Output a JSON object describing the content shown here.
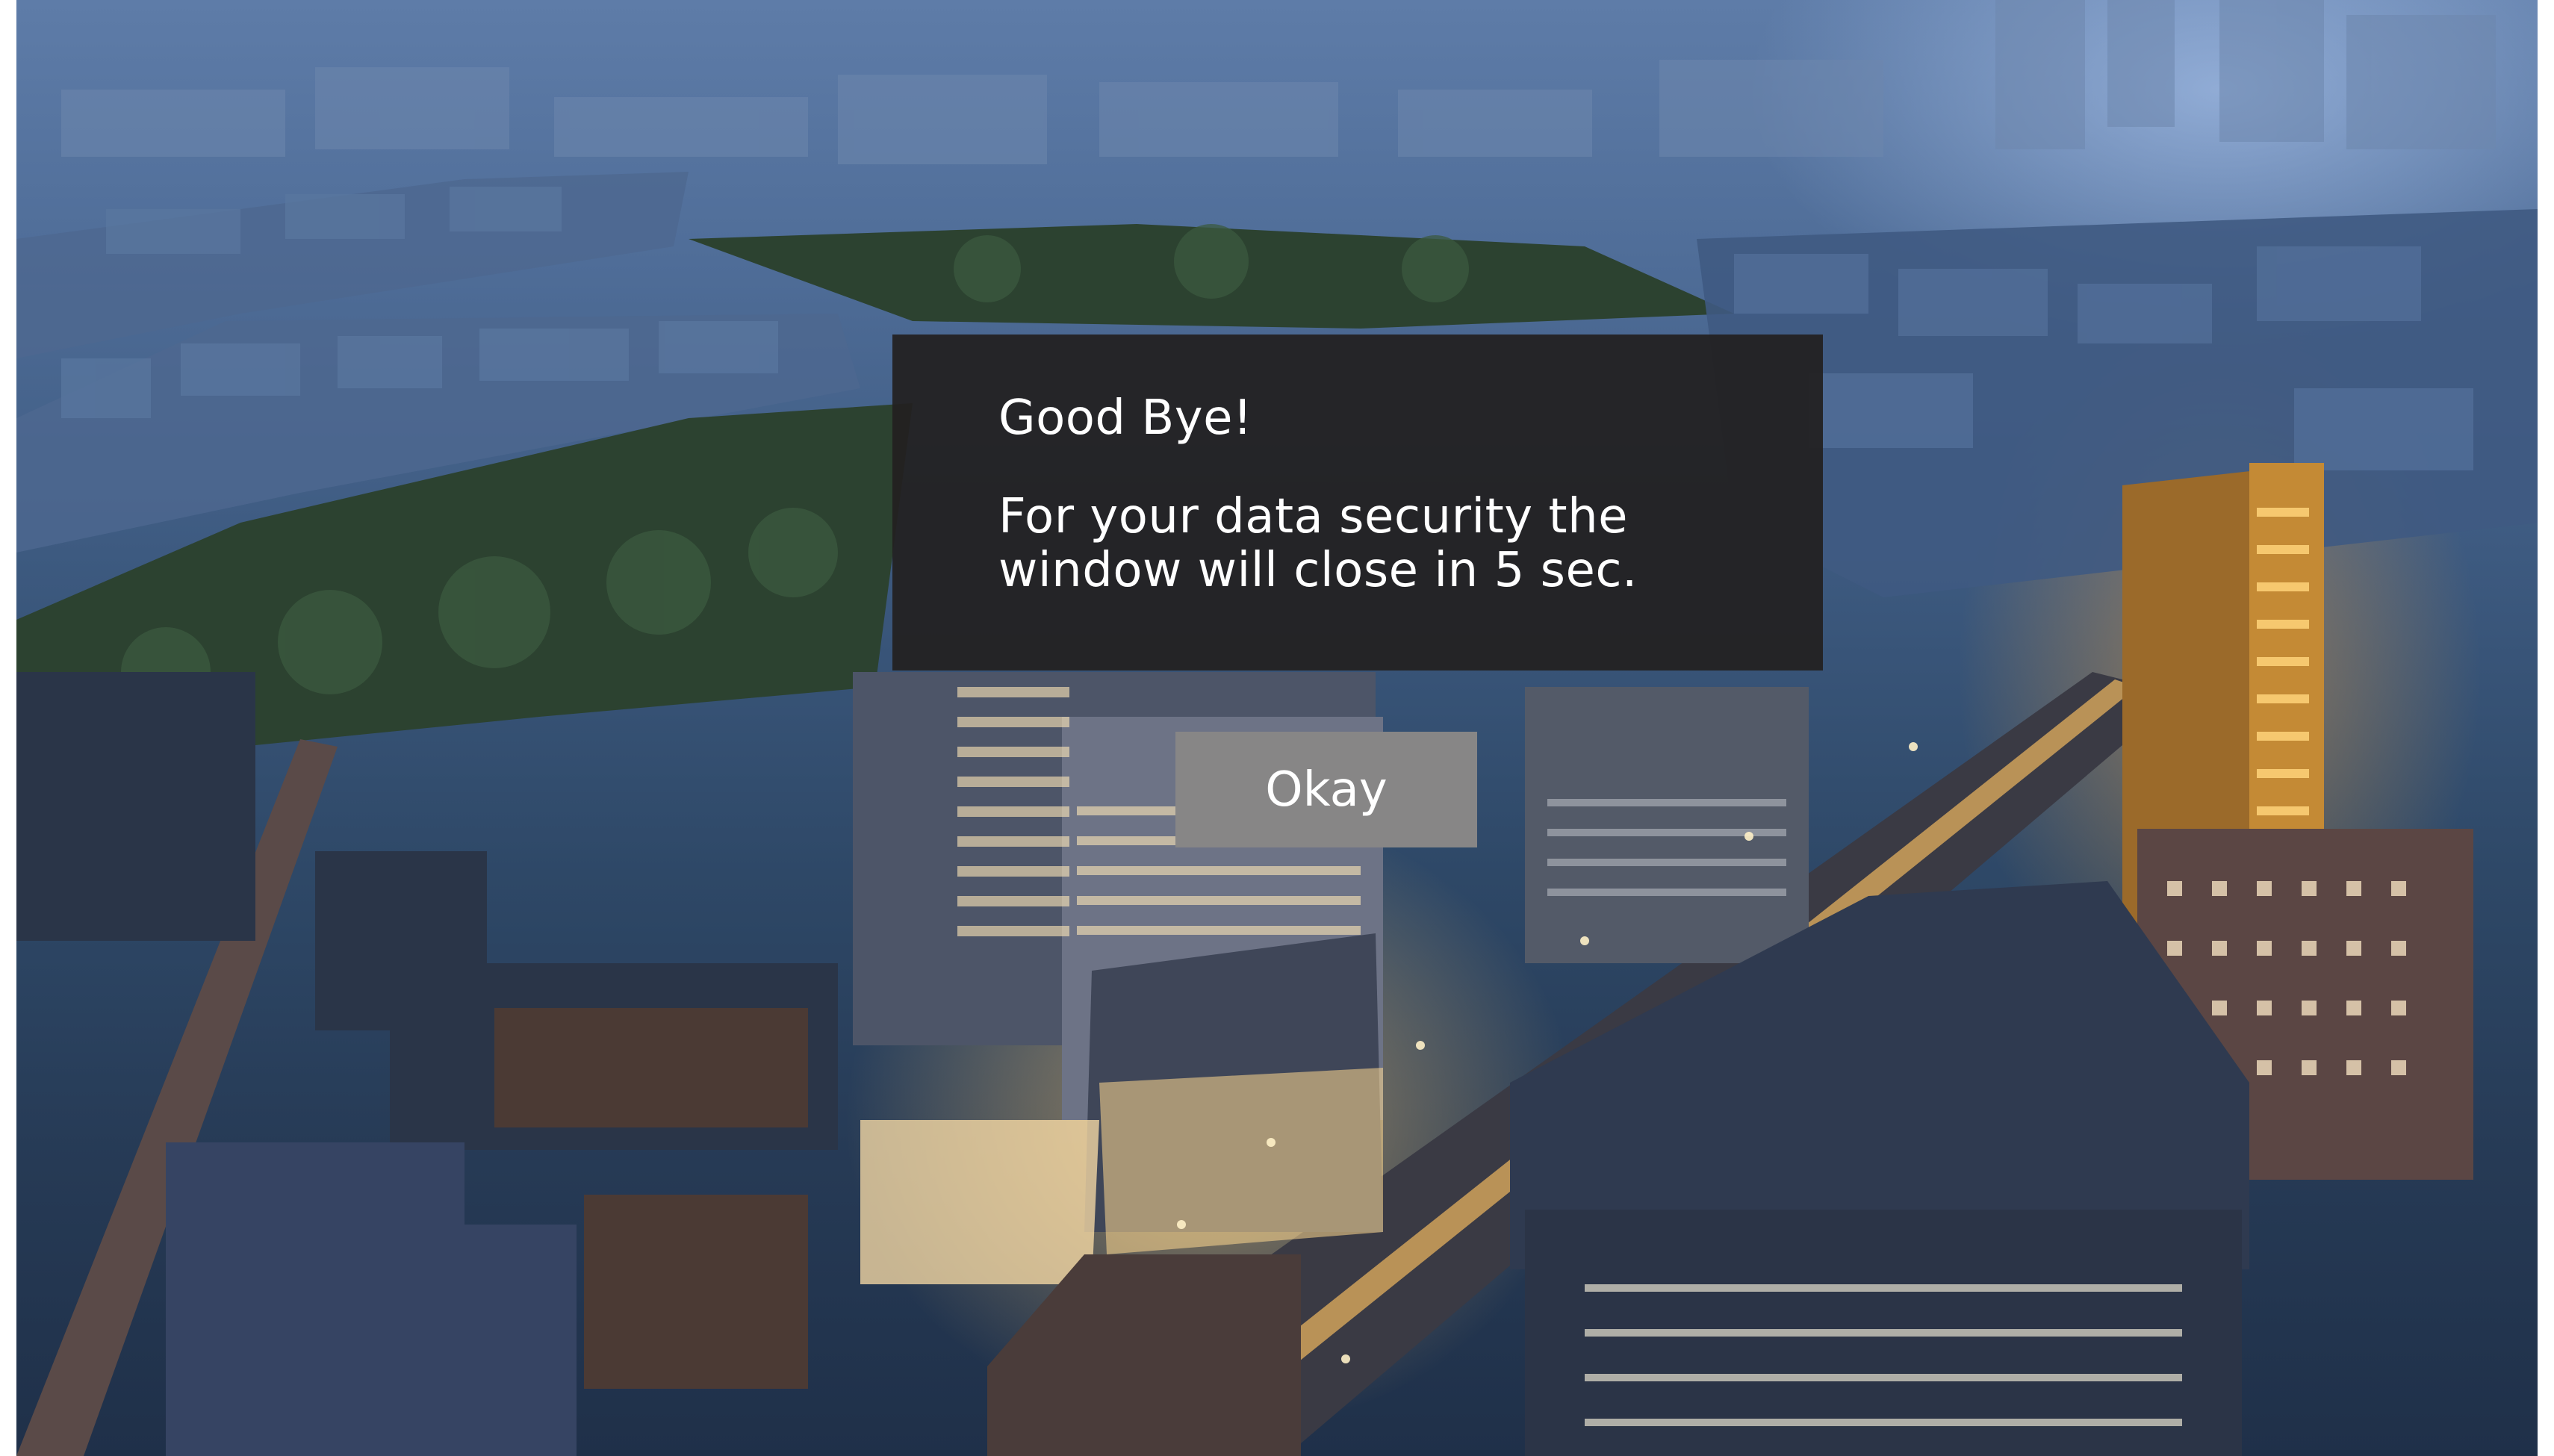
{
  "dialog": {
    "title": "Good Bye!",
    "message": "For your data security the window will close in 5 sec.",
    "countdown_seconds": 5
  },
  "okay_button": {
    "label": "Okay"
  },
  "background": {
    "description_icon": "city-aerial-night-image"
  },
  "colors": {
    "dialog_background": "#222020",
    "button_background": "#878686",
    "text": "#ffffff"
  }
}
